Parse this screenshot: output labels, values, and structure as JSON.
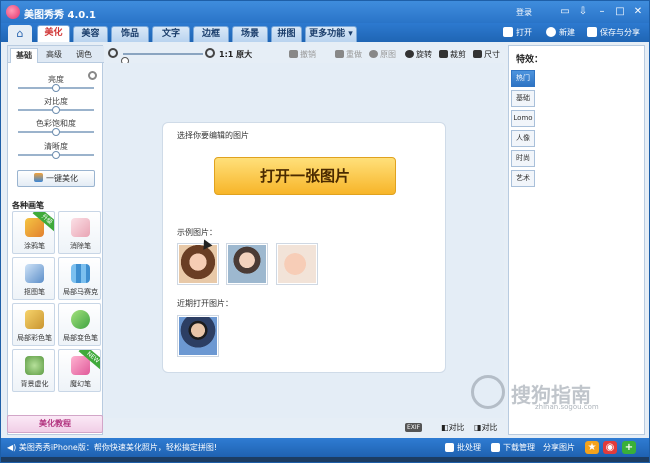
{
  "window": {
    "title": "美图秀秀 4.0.1",
    "login": "登录",
    "controls": [
      "minimize",
      "maximize",
      "close"
    ]
  },
  "menu": {
    "tabs": [
      {
        "label": "美化",
        "active": true
      },
      {
        "label": "美容",
        "active": false
      },
      {
        "label": "饰品",
        "active": false
      },
      {
        "label": "文字",
        "active": false
      },
      {
        "label": "边框",
        "active": false
      },
      {
        "label": "场景",
        "active": false
      },
      {
        "label": "拼图",
        "active": false
      },
      {
        "label": "更多功能 ▾",
        "active": false
      }
    ],
    "open_label": "打开",
    "new_label": "新建",
    "save_share_label": "保存与分享"
  },
  "left_panel": {
    "subtabs": [
      {
        "label": "基础",
        "active": true
      },
      {
        "label": "高级",
        "active": false
      },
      {
        "label": "调色",
        "active": false
      }
    ],
    "sliders": [
      {
        "label": "亮度",
        "value": 0.5
      },
      {
        "label": "对比度",
        "value": 0.5
      },
      {
        "label": "色彩饱和度",
        "value": 0.5
      },
      {
        "label": "清晰度",
        "value": 0.5
      }
    ],
    "auto_enhance_label": "一键美化",
    "brushes_title": "各种画笔",
    "tools": [
      {
        "label": "涂鸦笔",
        "icon": "pencil-icon",
        "badge": "升级"
      },
      {
        "label": "消除笔",
        "icon": "eraser-icon",
        "badge": ""
      },
      {
        "label": "抠图笔",
        "icon": "cutout-pen-icon",
        "badge": ""
      },
      {
        "label": "局部马赛克",
        "icon": "mosaic-icon",
        "badge": ""
      },
      {
        "label": "局部彩色笔",
        "icon": "color-brush-icon",
        "badge": ""
      },
      {
        "label": "局部变色笔",
        "icon": "recolor-brush-icon",
        "badge": ""
      },
      {
        "label": "背景虚化",
        "icon": "background-blur-icon",
        "badge": ""
      },
      {
        "label": "魔幻笔",
        "icon": "magic-pen-icon",
        "badge": "NEW"
      }
    ],
    "tutorial_label": "美化教程"
  },
  "canvas_toolbar": {
    "zoom_value": 0.0,
    "actual_size_label": "1:1 原大",
    "undo_label": "撤销",
    "redo_label": "重做",
    "original_label": "原图",
    "rotate_label": "旋转",
    "crop_label": "裁剪",
    "resize_label": "尺寸"
  },
  "canvas": {
    "prompt": "选择你要编辑的图片",
    "open_image_label": "打开一张图片",
    "samples_label": "示例图片：",
    "samples": [
      "sample-photo-woman",
      "sample-photo-girl",
      "sample-photo-baby"
    ],
    "recent_label": "近期打开图片：",
    "recent": [
      "recent-photo-man"
    ],
    "exif_label": "EXIF",
    "compare_label": "对比",
    "compare2_label": "对比"
  },
  "right_panel": {
    "title": "特效：",
    "tabs": [
      {
        "label": "热门",
        "active": true
      },
      {
        "label": "基础",
        "active": false
      },
      {
        "label": "Lomo",
        "active": false
      },
      {
        "label": "人像",
        "active": false
      },
      {
        "label": "时尚",
        "active": false
      },
      {
        "label": "艺术",
        "active": false
      }
    ]
  },
  "status_bar": {
    "message": "美图秀秀iPhone版：帮你快速美化照片，轻松搞定拼图!",
    "batch_label": "批处理",
    "download_label": "下载管理",
    "share_label": "分享图片"
  },
  "watermark": {
    "text": "搜狗指南",
    "url": "zhinan.sogou.com"
  },
  "colors": {
    "titlebar": "#2a74c8",
    "accent_red": "#d23a3a",
    "open_button": "#f7b529",
    "statusbar": "#1f62b1"
  }
}
